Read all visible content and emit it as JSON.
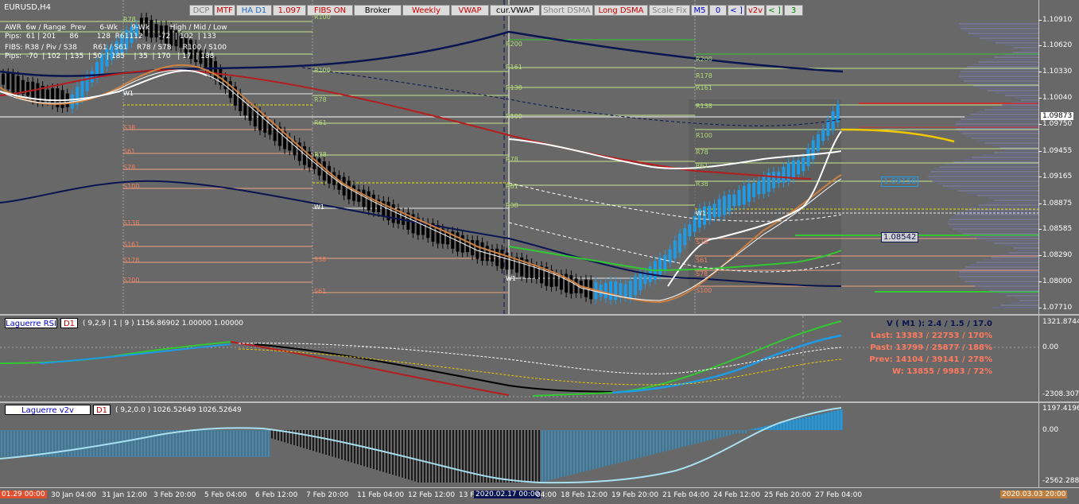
{
  "symbol_title": "EURUSD,H4",
  "toolbar": [
    {
      "label": "DCP",
      "color": "#808080"
    },
    {
      "label": "MTF",
      "color": "#c80000"
    },
    {
      "label": "HA D1",
      "color": "#1e6ec8"
    },
    {
      "label": "1.097",
      "color": "#c80000"
    },
    {
      "label": "FIBS ON",
      "color": "#c80000"
    },
    {
      "label": "Broker",
      "color": "#000000"
    },
    {
      "label": "Weekly",
      "color": "#c80000"
    },
    {
      "label": "VWAP",
      "color": "#c80000"
    },
    {
      "label": "cur.VWAP",
      "color": "#000000"
    },
    {
      "label": "Short DSMA",
      "color": "#808080"
    },
    {
      "label": "Long DSMA",
      "color": "#c80000"
    },
    {
      "label": "Scale Fix",
      "color": "#808080"
    },
    {
      "label": "M5",
      "color": "#0000c8"
    },
    {
      "label": "0",
      "color": "#0000c8"
    },
    {
      "label": "< ]",
      "color": "#0000c8"
    },
    {
      "label": "v2v",
      "color": "#c80000"
    },
    {
      "label": "< ]",
      "color": "#008000"
    },
    {
      "label": "3",
      "color": "#008000"
    }
  ],
  "info": {
    "row1": "AWR  6w / Range  Prev      6-Wk      9-Wk         High / Mid / Low",
    "row2": "Pips:  61 | 201      86        128  R61112       -72  | 102  | 133",
    "row3": "FIBS: R38 / Piv / S38       R61 / S61    R78 / S78     R100 / S100",
    "row4": "Pips:  -70  | 102  | 135  | 50  | 185    | 35  | 170   | 17  | 188"
  },
  "price_axis": [
    "1.10910",
    "1.10620",
    "1.10330",
    "1.10040",
    "1.09750",
    "1.09455",
    "1.09165",
    "1.08875",
    "1.08585",
    "1.08290",
    "1.08000",
    "1.07710"
  ],
  "current_price": "1.09873",
  "price_tags": [
    "1.09158",
    "1.08542"
  ],
  "fib_levels_left": [
    "R78",
    "W1",
    "S38",
    "S61",
    "S78",
    "S100",
    "S138",
    "S161",
    "S178",
    "S200"
  ],
  "fib_levels_mid": [
    "R100",
    "R100",
    "R78",
    "R61",
    "R38",
    "W1",
    "S38",
    "S61"
  ],
  "fib_levels_col3": [
    "R200",
    "R161",
    "R138",
    "R100",
    "R78",
    "R61",
    "R38",
    "W1"
  ],
  "fib_levels_right": [
    "R200",
    "R178",
    "R161",
    "R138",
    "R100",
    "R78",
    "R61",
    "R38",
    "W1",
    "S38",
    "S61",
    "S78",
    "S100"
  ],
  "laguerre_rsi": {
    "name": "Laguerre RSI",
    "tf": "D1",
    "params": "( 9,2,9 | 1 | 9 ) 1156.86902 1.00000 1.00000",
    "axis": [
      "1321.8744",
      "0.00",
      "-2308.3071"
    ],
    "stats": [
      "V ( M1 ): 2.4 / 1.5 / 17.0",
      "Last: 13383 / 22753 / 170%",
      "Past: 13799 / 25877 / 188%",
      "Prev: 14104 / 39141 / 278%",
      "W: 13855 / 9983 / 72%"
    ]
  },
  "laguerre_v2v": {
    "name": "Laguerre v2v",
    "tf": "D1",
    "params": "( 9,2,0.0 ) 1026.52649 1026.52649",
    "axis": [
      "1197.4196",
      "0.00",
      "-2562.2881"
    ]
  },
  "time_axis": {
    "left_marker": "01.29 00:00",
    "labels": [
      "30 Jan 04:00",
      "31 Jan 12:00",
      "3 Feb 20:00",
      "5 Feb 04:00",
      "6 Feb 12:00",
      "7 Feb 20:00",
      "11 Feb 04:00",
      "12 Feb 12:00",
      "13 F",
      "04:00",
      "18 Feb 12:00",
      "19 Feb 20:00",
      "21 Feb 04:00",
      "24 Feb 12:00",
      "25 Feb 20:00",
      "27 Feb 04:00"
    ],
    "cursor_time": "2020.02.17 00:00",
    "right_marker": "2020.03.03 20:00"
  },
  "colors": {
    "bg": "#686868",
    "bull": "#1e9be6",
    "bear": "#000000",
    "red": "#b41e1e",
    "navy": "#0a1450",
    "green": "#32c832",
    "yellow": "#e6c800"
  },
  "chart_data": {
    "type": "line",
    "ylim": [
      1.0771,
      1.0921
    ],
    "price_series": [
      1.1025,
      1.101,
      1.1,
      1.105,
      1.1085,
      1.107,
      1.104,
      1.099,
      1.096,
      1.093,
      1.09,
      1.088,
      1.086,
      1.0845,
      1.083,
      1.0815,
      1.08,
      1.079,
      1.079,
      1.082,
      1.087,
      1.089,
      1.091,
      1.093,
      1.0987
    ]
  }
}
